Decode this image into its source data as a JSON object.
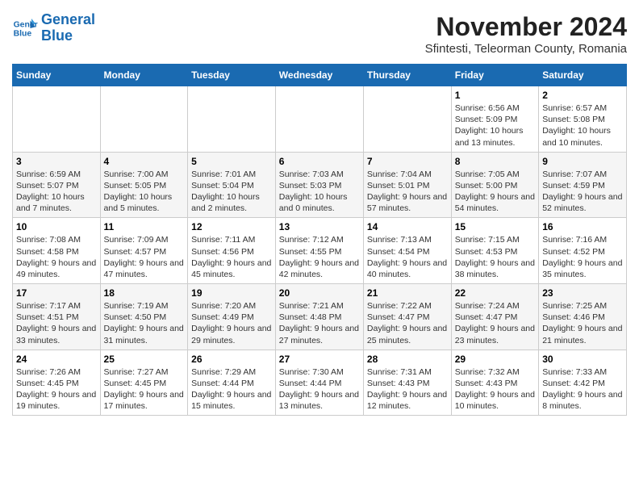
{
  "logo": {
    "line1": "General",
    "line2": "Blue"
  },
  "title": "November 2024",
  "subtitle": "Sfintesti, Teleorman County, Romania",
  "headers": [
    "Sunday",
    "Monday",
    "Tuesday",
    "Wednesday",
    "Thursday",
    "Friday",
    "Saturday"
  ],
  "weeks": [
    [
      {
        "day": "",
        "info": ""
      },
      {
        "day": "",
        "info": ""
      },
      {
        "day": "",
        "info": ""
      },
      {
        "day": "",
        "info": ""
      },
      {
        "day": "",
        "info": ""
      },
      {
        "day": "1",
        "info": "Sunrise: 6:56 AM\nSunset: 5:09 PM\nDaylight: 10 hours and 13 minutes."
      },
      {
        "day": "2",
        "info": "Sunrise: 6:57 AM\nSunset: 5:08 PM\nDaylight: 10 hours and 10 minutes."
      }
    ],
    [
      {
        "day": "3",
        "info": "Sunrise: 6:59 AM\nSunset: 5:07 PM\nDaylight: 10 hours and 7 minutes."
      },
      {
        "day": "4",
        "info": "Sunrise: 7:00 AM\nSunset: 5:05 PM\nDaylight: 10 hours and 5 minutes."
      },
      {
        "day": "5",
        "info": "Sunrise: 7:01 AM\nSunset: 5:04 PM\nDaylight: 10 hours and 2 minutes."
      },
      {
        "day": "6",
        "info": "Sunrise: 7:03 AM\nSunset: 5:03 PM\nDaylight: 10 hours and 0 minutes."
      },
      {
        "day": "7",
        "info": "Sunrise: 7:04 AM\nSunset: 5:01 PM\nDaylight: 9 hours and 57 minutes."
      },
      {
        "day": "8",
        "info": "Sunrise: 7:05 AM\nSunset: 5:00 PM\nDaylight: 9 hours and 54 minutes."
      },
      {
        "day": "9",
        "info": "Sunrise: 7:07 AM\nSunset: 4:59 PM\nDaylight: 9 hours and 52 minutes."
      }
    ],
    [
      {
        "day": "10",
        "info": "Sunrise: 7:08 AM\nSunset: 4:58 PM\nDaylight: 9 hours and 49 minutes."
      },
      {
        "day": "11",
        "info": "Sunrise: 7:09 AM\nSunset: 4:57 PM\nDaylight: 9 hours and 47 minutes."
      },
      {
        "day": "12",
        "info": "Sunrise: 7:11 AM\nSunset: 4:56 PM\nDaylight: 9 hours and 45 minutes."
      },
      {
        "day": "13",
        "info": "Sunrise: 7:12 AM\nSunset: 4:55 PM\nDaylight: 9 hours and 42 minutes."
      },
      {
        "day": "14",
        "info": "Sunrise: 7:13 AM\nSunset: 4:54 PM\nDaylight: 9 hours and 40 minutes."
      },
      {
        "day": "15",
        "info": "Sunrise: 7:15 AM\nSunset: 4:53 PM\nDaylight: 9 hours and 38 minutes."
      },
      {
        "day": "16",
        "info": "Sunrise: 7:16 AM\nSunset: 4:52 PM\nDaylight: 9 hours and 35 minutes."
      }
    ],
    [
      {
        "day": "17",
        "info": "Sunrise: 7:17 AM\nSunset: 4:51 PM\nDaylight: 9 hours and 33 minutes."
      },
      {
        "day": "18",
        "info": "Sunrise: 7:19 AM\nSunset: 4:50 PM\nDaylight: 9 hours and 31 minutes."
      },
      {
        "day": "19",
        "info": "Sunrise: 7:20 AM\nSunset: 4:49 PM\nDaylight: 9 hours and 29 minutes."
      },
      {
        "day": "20",
        "info": "Sunrise: 7:21 AM\nSunset: 4:48 PM\nDaylight: 9 hours and 27 minutes."
      },
      {
        "day": "21",
        "info": "Sunrise: 7:22 AM\nSunset: 4:47 PM\nDaylight: 9 hours and 25 minutes."
      },
      {
        "day": "22",
        "info": "Sunrise: 7:24 AM\nSunset: 4:47 PM\nDaylight: 9 hours and 23 minutes."
      },
      {
        "day": "23",
        "info": "Sunrise: 7:25 AM\nSunset: 4:46 PM\nDaylight: 9 hours and 21 minutes."
      }
    ],
    [
      {
        "day": "24",
        "info": "Sunrise: 7:26 AM\nSunset: 4:45 PM\nDaylight: 9 hours and 19 minutes."
      },
      {
        "day": "25",
        "info": "Sunrise: 7:27 AM\nSunset: 4:45 PM\nDaylight: 9 hours and 17 minutes."
      },
      {
        "day": "26",
        "info": "Sunrise: 7:29 AM\nSunset: 4:44 PM\nDaylight: 9 hours and 15 minutes."
      },
      {
        "day": "27",
        "info": "Sunrise: 7:30 AM\nSunset: 4:44 PM\nDaylight: 9 hours and 13 minutes."
      },
      {
        "day": "28",
        "info": "Sunrise: 7:31 AM\nSunset: 4:43 PM\nDaylight: 9 hours and 12 minutes."
      },
      {
        "day": "29",
        "info": "Sunrise: 7:32 AM\nSunset: 4:43 PM\nDaylight: 9 hours and 10 minutes."
      },
      {
        "day": "30",
        "info": "Sunrise: 7:33 AM\nSunset: 4:42 PM\nDaylight: 9 hours and 8 minutes."
      }
    ]
  ]
}
